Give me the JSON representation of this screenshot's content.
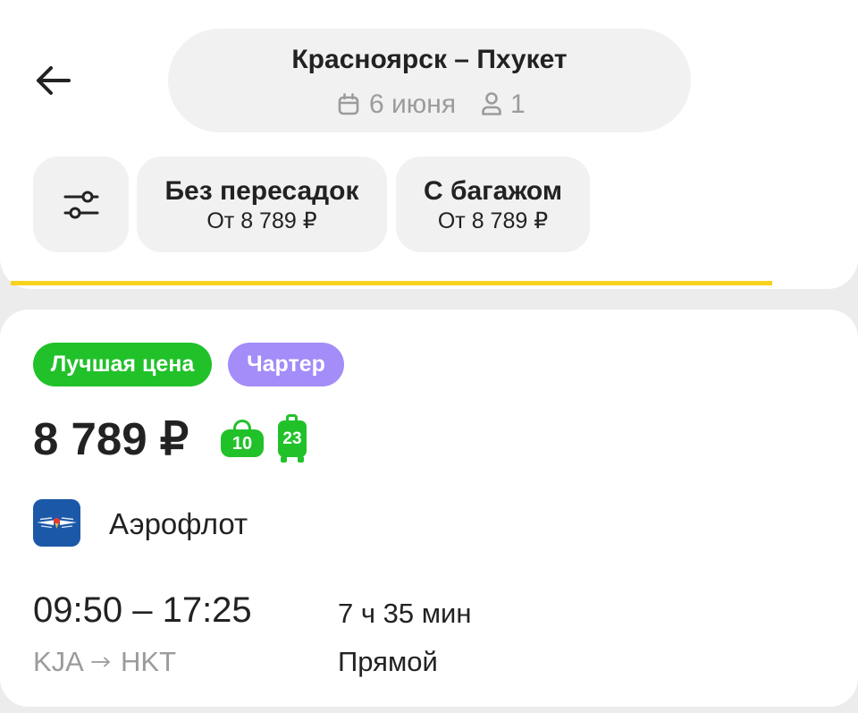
{
  "header": {
    "back_icon": "arrow-left-icon",
    "route_title": "Красноярск – Пхукет",
    "date_icon": "calendar-icon",
    "date": "6 июня",
    "passengers_icon": "person-icon",
    "passengers": "1"
  },
  "filters": {
    "settings_icon": "sliders-icon",
    "chips": [
      {
        "label": "Без пересадок",
        "price": "От 8 789 ₽"
      },
      {
        "label": "С багажом",
        "price": "От 8 789 ₽"
      }
    ]
  },
  "loading": {
    "progress": 0.91,
    "color": "#f8d21c"
  },
  "result": {
    "badges": [
      {
        "label": "Лучшая цена",
        "color": "#21c12a"
      },
      {
        "label": "Чартер",
        "color": "#a48cf9"
      }
    ],
    "price": "8 789 ₽",
    "baggage": {
      "hand_luggage_icon": "hand-luggage-icon",
      "hand_luggage": "10",
      "checked_baggage_icon": "suitcase-icon",
      "checked_baggage": "23",
      "color": "#21c12a"
    },
    "airline": {
      "logo_icon": "aeroflot-logo-icon",
      "logo_color": "#1c58a8",
      "name": "Аэрофлот"
    },
    "time_range": "09:50 – 17:25",
    "duration": "7 ч 35 мин",
    "route": {
      "from": "KJA",
      "arrow_icon": "arrow-right-icon",
      "to": "HKT"
    },
    "stops": "Прямой"
  },
  "colors": {
    "text": "#222222",
    "muted": "#9b9b9b",
    "chip_bg": "#f1f1f1",
    "page_bg": "#ececec"
  }
}
